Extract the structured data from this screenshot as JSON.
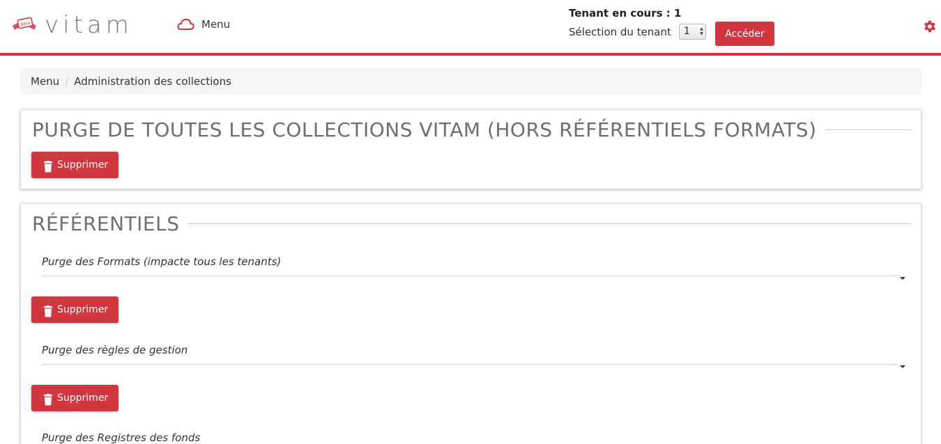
{
  "header": {
    "logo_badge": "Bêta",
    "logo_text": "vitam",
    "menu_label": "Menu",
    "tenant_current": "Tenant en cours : 1",
    "tenant_select_label": "Sélection du tenant",
    "tenant_select_value": "1",
    "access_button": "Accéder",
    "accent_color": "#d2363f"
  },
  "breadcrumb": [
    "Menu",
    "Administration des collections"
  ],
  "panels": {
    "purge_all": {
      "title": "PURGE DE TOUTES LES COLLECTIONS VITAM (HORS RÉFÉRENTIELS FORMATS)",
      "button": "Supprimer"
    },
    "referentiels": {
      "title": "RÉFÉRENTIELS",
      "items": [
        {
          "label": "Purge des Formats (impacte tous les tenants)",
          "button": "Supprimer"
        },
        {
          "label": "Purge des règles de gestion",
          "button": "Supprimer"
        },
        {
          "label": "Purge des Registres des fonds"
        }
      ]
    }
  }
}
